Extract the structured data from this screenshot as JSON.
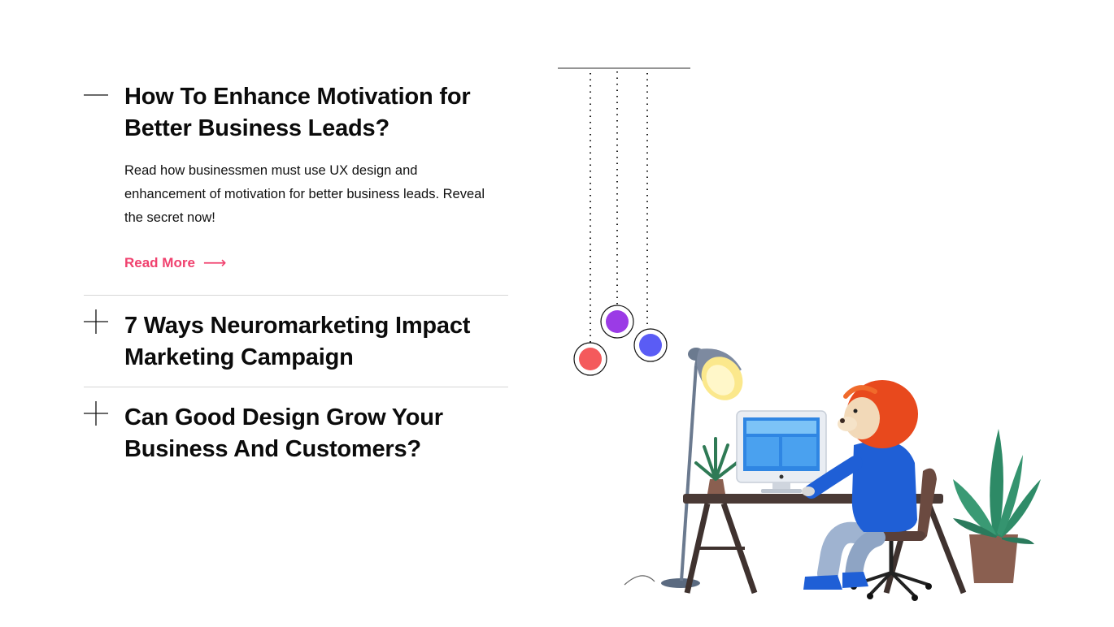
{
  "accordion": {
    "items": [
      {
        "title": "How To Enhance Motivation for Better Business Leads?",
        "expanded": true,
        "description": "Read how businessmen must use UX design and enhancement of motivation for better business leads. Reveal the secret now!",
        "read_more_label": "Read More",
        "read_more_arrow": "⟶"
      },
      {
        "title": "7 Ways Neuromarketing Impact Marketing Campaign",
        "expanded": false
      },
      {
        "title": "Can Good Design Grow Your Business And Customers?",
        "expanded": false
      }
    ]
  },
  "colors": {
    "accent": "#f0416e",
    "ball_red": "#f45a5c",
    "ball_purple": "#9b3be6",
    "ball_blue": "#5a5cf5",
    "hoodie": "#1f5fd6",
    "mane": "#e8491d"
  },
  "icons": {
    "collapse": "minus-icon",
    "expand": "plus-icon"
  }
}
